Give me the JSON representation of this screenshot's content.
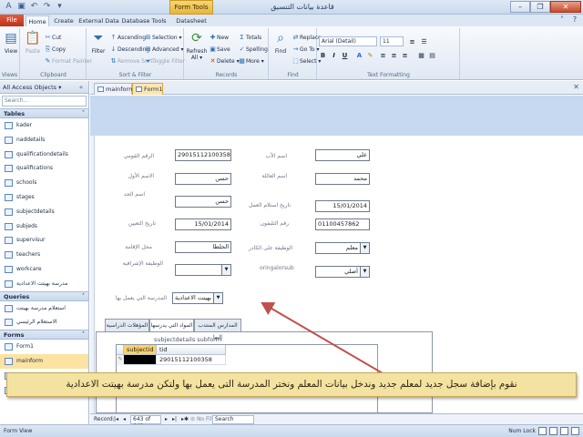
{
  "title_bar": {
    "app_title": "قاعدة بيانات التنسيق",
    "context_tab": "Form Tools",
    "qat_icons": [
      "access-logo-icon",
      "save-icon",
      "undo-icon",
      "redo-icon",
      "customize-qat-icon"
    ],
    "window_controls": [
      "minimize-icon",
      "restore-icon",
      "close-icon"
    ]
  },
  "ribbon_tabs": {
    "file": "File",
    "tabs": [
      "Home",
      "Create",
      "External Data",
      "Database Tools",
      "Datasheet"
    ],
    "active": "Home"
  },
  "ribbon": {
    "views": {
      "label": "Views",
      "view_button": "View"
    },
    "clipboard": {
      "label": "Clipboard",
      "paste": "Paste",
      "cut": "Cut",
      "copy": "Copy",
      "format_painter": "Format Painter"
    },
    "sort_filter": {
      "label": "Sort & Filter",
      "filter": "Filter",
      "ascending": "Ascending",
      "descending": "Descending",
      "remove_sort": "Remove Sort",
      "selection": "Selection ▾",
      "advanced": "Advanced ▾",
      "toggle_filter": "Toggle Filter"
    },
    "records": {
      "label": "Records",
      "refresh": "Refresh All ▾",
      "new": "New",
      "save": "Save",
      "delete": "Delete ▾",
      "totals": "Totals",
      "spelling": "Spelling",
      "more": "More ▾"
    },
    "find": {
      "label": "Find",
      "find": "Find",
      "replace": "Replace",
      "goto": "Go To ▾",
      "select": "Select ▾"
    },
    "text_formatting": {
      "label": "Text Formatting",
      "font": "Arial (Detail)",
      "size": "11"
    }
  },
  "nav_pane": {
    "header": "All Access Objects",
    "search_placeholder": "Search...",
    "sections": [
      {
        "name": "Tables",
        "items": [
          "kader",
          "naddetails",
          "qualificationdetails",
          "qualifications",
          "schools",
          "stages",
          "subjectdetails",
          "subjeds",
          "supervisur",
          "teachers",
          "workcare",
          "مدرسة بهيتت الاعدادية"
        ]
      },
      {
        "name": "Queries",
        "items": [
          "استعلام مدرسة بهيتت",
          "الاستعلام الرئيسي"
        ]
      },
      {
        "name": "Forms",
        "items": [
          "Form1",
          "mainform",
          "qualifications",
          "schools"
        ]
      }
    ],
    "selected_item": "mainform"
  },
  "doc_tabs": {
    "tabs": [
      "mainform",
      "Form1"
    ],
    "active": "Form1"
  },
  "form": {
    "fields": {
      "national_id_label": "الرقم القومي",
      "national_id_value": "29015112100358",
      "father_name_label": "اسم الأب",
      "father_name_value": "علي",
      "first_name_label": "الاسم الأول",
      "first_name_value": "حسن",
      "family_name_label": "اسم العائلة",
      "family_name_value": "محمد",
      "grandfather_label": "اسم الجد",
      "grandfather_value": "حسن",
      "start_date_label": "تاريخ استلام العمل",
      "start_date_value": "15/01/2014",
      "appointment_date_label": "تاريخ التعيين",
      "appointment_date_value": "15/01/2014",
      "phone_label": "رقم التليفون",
      "phone_value": "01100457862",
      "residence_label": "محل الإقامة",
      "residence_value": "الجلطا",
      "job_label": "الوظيفة على الكادر",
      "job_value": "معلم",
      "supervisory_label": "الوظيفة الإشرافية",
      "supervisory_value": "",
      "orig_sub_label": "oringalorsub",
      "orig_sub_value": "أصلي",
      "school_label": "المدرسة التي يعمل بها",
      "school_value": "بهيتت الاعدادية"
    },
    "sub_tabs": [
      "المدارس المنتدب إليها",
      "المواد التي يدرسها",
      "المؤهلات الدراسية"
    ],
    "active_sub_tab": "المواد التي يدرسها",
    "subform": {
      "label": "subjectdetails subform",
      "columns": [
        "subjectid",
        "tid"
      ],
      "rows": [
        {
          "subjectid": "",
          "tid": "29015112100358"
        }
      ]
    }
  },
  "caption": "نقوم بإضافة سجل جديد لمعلم جديد وندخل بيانات المعلم ونختر المدرسة التى يعمل بها ولتكن مدرسة بهيتت الاعدادية",
  "record_nav": {
    "label": "Record:",
    "position": "643 of 643",
    "filter": "No Filter",
    "search": "Search"
  },
  "status": {
    "left": "Form View",
    "num_lock": "Num Lock"
  },
  "colors": {
    "file_tab": "#c43f24",
    "form_header": "#c6d9f1",
    "caption_bg": "#f3e2a0",
    "arrow": "#c0504d"
  }
}
